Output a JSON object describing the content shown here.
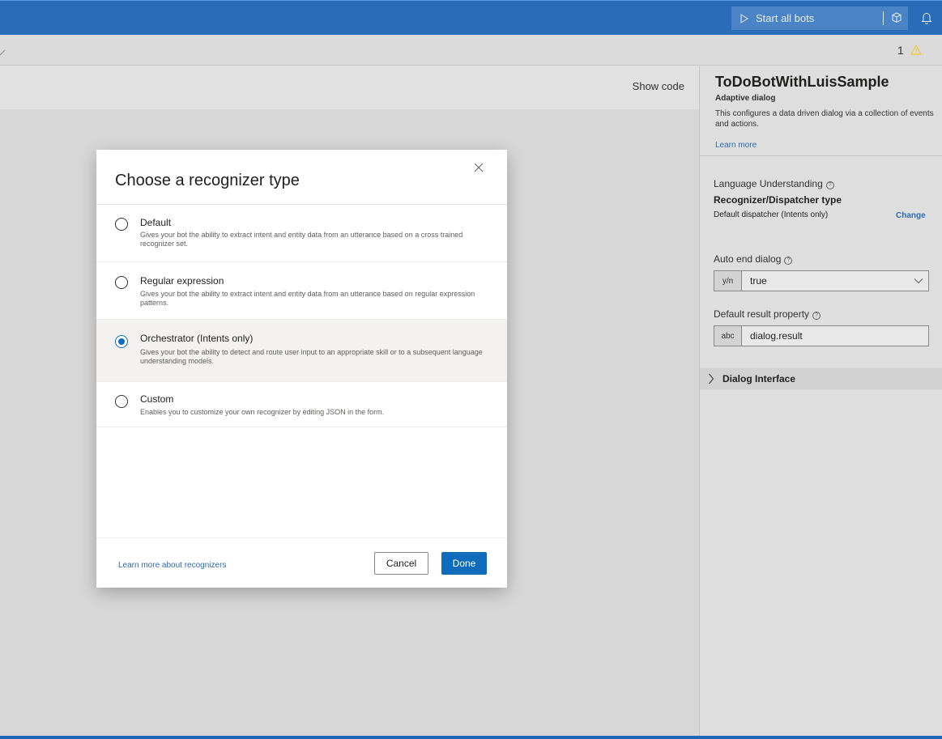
{
  "topbar": {
    "start_all_bots": "Start all bots"
  },
  "breadcrumb": {
    "warning_count": "1"
  },
  "canvas": {
    "show_code": "Show code"
  },
  "panel": {
    "title": "ToDoBotWithLuisSample",
    "subtitle": "Adaptive dialog",
    "description": "This configures a data driven dialog via a collection of events and actions.",
    "learn_more": "Learn more",
    "language_understanding": "Language Understanding",
    "recognizer_type_label": "Recognizer/Dispatcher type",
    "recognizer_type_value": "Default dispatcher (Intents only)",
    "change": "Change",
    "auto_end_label": "Auto end dialog",
    "auto_end_prefix": "y/n",
    "auto_end_value": "true",
    "default_result_label": "Default result property",
    "default_result_prefix": "abc",
    "default_result_value": "dialog.result",
    "dialog_interface": "Dialog Interface"
  },
  "modal": {
    "title": "Choose a recognizer type",
    "options": [
      {
        "title": "Default",
        "description": "Gives your bot the ability to extract intent and entity data from an utterance based on a cross trained recognizer set.",
        "selected": false
      },
      {
        "title": "Regular expression",
        "description": "Gives your bot the ability to extract intent and entity data from an utterance based on regular expression patterns.",
        "selected": false
      },
      {
        "title": "Orchestrator (Intents only)",
        "description": "Gives your bot the ability to detect and route user input to an appropriate skill or to a subsequent language understanding models.",
        "selected": true
      },
      {
        "title": "Custom",
        "description": "Enables you to customize your own recognizer by editing JSON in the form.",
        "selected": false
      }
    ],
    "learn_more": "Learn more about recognizers",
    "cancel": "Cancel",
    "done": "Done"
  },
  "colors": {
    "accent": "#0f6cbd",
    "topbar": "#2a6cb8",
    "link": "#2f6bb0",
    "warning": "#f2c811"
  },
  "icons": [
    "play-icon",
    "cube-icon",
    "bell-icon",
    "chevron-down-icon",
    "warning-icon",
    "info-icon",
    "close-icon",
    "chevron-right-icon"
  ]
}
